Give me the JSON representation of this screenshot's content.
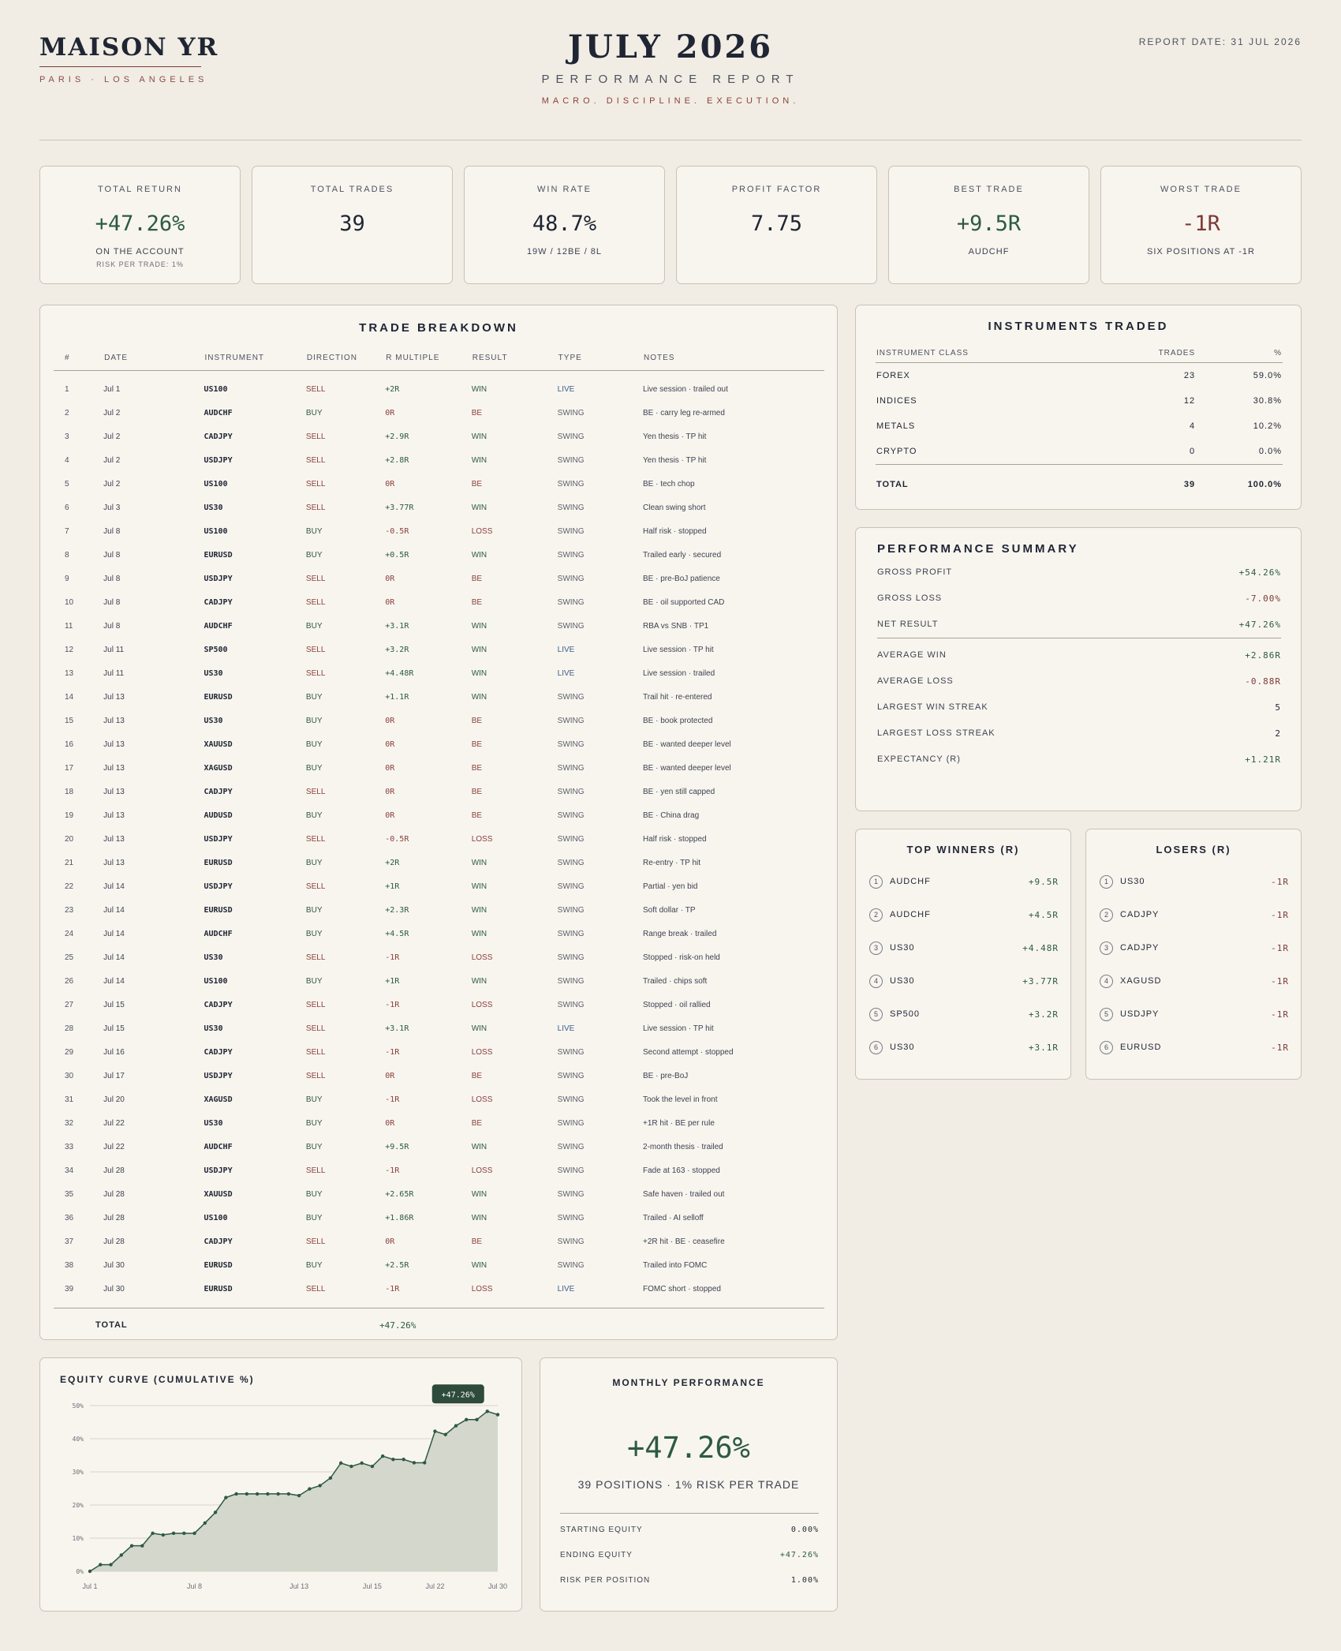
{
  "header": {
    "brand": "MAISON YR",
    "brand_sub": "PARIS · LOS ANGELES",
    "title": "JULY 2026",
    "subtitle": "PERFORMANCE REPORT",
    "tagline": "MACRO. DISCIPLINE. EXECUTION.",
    "report_date": "REPORT DATE: 31 JUL 2026"
  },
  "kpis": [
    {
      "label": "TOTAL RETURN",
      "value": "+47.26%",
      "sub1": "ON THE ACCOUNT",
      "sub2": "RISK PER TRADE: 1%",
      "tone": "pos"
    },
    {
      "label": "TOTAL TRADES",
      "value": "39",
      "sub1": "",
      "sub2": "",
      "tone": ""
    },
    {
      "label": "WIN RATE",
      "value": "48.7%",
      "sub1": "19W / 12BE / 8L",
      "sub2": "",
      "tone": ""
    },
    {
      "label": "PROFIT FACTOR",
      "value": "7.75",
      "sub1": "",
      "sub2": "",
      "tone": ""
    },
    {
      "label": "BEST TRADE",
      "value": "+9.5R",
      "sub1": "AUDCHF",
      "sub2": "",
      "tone": "pos"
    },
    {
      "label": "WORST TRADE",
      "value": "-1R",
      "sub1": "SIX POSITIONS AT -1R",
      "sub2": "",
      "tone": "neg"
    }
  ],
  "trades": {
    "title": "TRADE BREAKDOWN",
    "columns": [
      "#",
      "DATE",
      "INSTRUMENT",
      "DIRECTION",
      "R MULTIPLE",
      "RESULT",
      "TYPE",
      "NOTES"
    ],
    "rows": [
      [
        "1",
        "Jul 1",
        "US100",
        "SELL",
        "+2R",
        "WIN",
        "LIVE",
        "Live session · trailed out"
      ],
      [
        "2",
        "Jul 2",
        "AUDCHF",
        "BUY",
        "0R",
        "BE",
        "SWING",
        "BE · carry leg re-armed"
      ],
      [
        "3",
        "Jul 2",
        "CADJPY",
        "SELL",
        "+2.9R",
        "WIN",
        "SWING",
        "Yen thesis · TP hit"
      ],
      [
        "4",
        "Jul 2",
        "USDJPY",
        "SELL",
        "+2.8R",
        "WIN",
        "SWING",
        "Yen thesis · TP hit"
      ],
      [
        "5",
        "Jul 2",
        "US100",
        "SELL",
        "0R",
        "BE",
        "SWING",
        "BE · tech chop"
      ],
      [
        "6",
        "Jul 3",
        "US30",
        "SELL",
        "+3.77R",
        "WIN",
        "SWING",
        "Clean swing short"
      ],
      [
        "7",
        "Jul 8",
        "US100",
        "BUY",
        "-0.5R",
        "LOSS",
        "SWING",
        "Half risk · stopped"
      ],
      [
        "8",
        "Jul 8",
        "EURUSD",
        "BUY",
        "+0.5R",
        "WIN",
        "SWING",
        "Trailed early · secured"
      ],
      [
        "9",
        "Jul 8",
        "USDJPY",
        "SELL",
        "0R",
        "BE",
        "SWING",
        "BE · pre-BoJ patience"
      ],
      [
        "10",
        "Jul 8",
        "CADJPY",
        "SELL",
        "0R",
        "BE",
        "SWING",
        "BE · oil supported CAD"
      ],
      [
        "11",
        "Jul 8",
        "AUDCHF",
        "BUY",
        "+3.1R",
        "WIN",
        "SWING",
        "RBA vs SNB · TP1"
      ],
      [
        "12",
        "Jul 11",
        "SP500",
        "SELL",
        "+3.2R",
        "WIN",
        "LIVE",
        "Live session · TP hit"
      ],
      [
        "13",
        "Jul 11",
        "US30",
        "SELL",
        "+4.48R",
        "WIN",
        "LIVE",
        "Live session · trailed"
      ],
      [
        "14",
        "Jul 13",
        "EURUSD",
        "BUY",
        "+1.1R",
        "WIN",
        "SWING",
        "Trail hit · re-entered"
      ],
      [
        "15",
        "Jul 13",
        "US30",
        "BUY",
        "0R",
        "BE",
        "SWING",
        "BE · book protected"
      ],
      [
        "16",
        "Jul 13",
        "XAUUSD",
        "BUY",
        "0R",
        "BE",
        "SWING",
        "BE · wanted deeper level"
      ],
      [
        "17",
        "Jul 13",
        "XAGUSD",
        "BUY",
        "0R",
        "BE",
        "SWING",
        "BE · wanted deeper level"
      ],
      [
        "18",
        "Jul 13",
        "CADJPY",
        "SELL",
        "0R",
        "BE",
        "SWING",
        "BE · yen still capped"
      ],
      [
        "19",
        "Jul 13",
        "AUDUSD",
        "BUY",
        "0R",
        "BE",
        "SWING",
        "BE · China drag"
      ],
      [
        "20",
        "Jul 13",
        "USDJPY",
        "SELL",
        "-0.5R",
        "LOSS",
        "SWING",
        "Half risk · stopped"
      ],
      [
        "21",
        "Jul 13",
        "EURUSD",
        "BUY",
        "+2R",
        "WIN",
        "SWING",
        "Re-entry · TP hit"
      ],
      [
        "22",
        "Jul 14",
        "USDJPY",
        "SELL",
        "+1R",
        "WIN",
        "SWING",
        "Partial · yen bid"
      ],
      [
        "23",
        "Jul 14",
        "EURUSD",
        "BUY",
        "+2.3R",
        "WIN",
        "SWING",
        "Soft dollar · TP"
      ],
      [
        "24",
        "Jul 14",
        "AUDCHF",
        "BUY",
        "+4.5R",
        "WIN",
        "SWING",
        "Range break · trailed"
      ],
      [
        "25",
        "Jul 14",
        "US30",
        "SELL",
        "-1R",
        "LOSS",
        "SWING",
        "Stopped · risk-on held"
      ],
      [
        "26",
        "Jul 14",
        "US100",
        "BUY",
        "+1R",
        "WIN",
        "SWING",
        "Trailed · chips soft"
      ],
      [
        "27",
        "Jul 15",
        "CADJPY",
        "SELL",
        "-1R",
        "LOSS",
        "SWING",
        "Stopped · oil rallied"
      ],
      [
        "28",
        "Jul 15",
        "US30",
        "SELL",
        "+3.1R",
        "WIN",
        "LIVE",
        "Live session · TP hit"
      ],
      [
        "29",
        "Jul 16",
        "CADJPY",
        "SELL",
        "-1R",
        "LOSS",
        "SWING",
        "Second attempt · stopped"
      ],
      [
        "30",
        "Jul 17",
        "USDJPY",
        "SELL",
        "0R",
        "BE",
        "SWING",
        "BE · pre-BoJ"
      ],
      [
        "31",
        "Jul 20",
        "XAGUSD",
        "BUY",
        "-1R",
        "LOSS",
        "SWING",
        "Took the level in front"
      ],
      [
        "32",
        "Jul 22",
        "US30",
        "BUY",
        "0R",
        "BE",
        "SWING",
        "+1R hit · BE per rule"
      ],
      [
        "33",
        "Jul 22",
        "AUDCHF",
        "BUY",
        "+9.5R",
        "WIN",
        "SWING",
        "2-month thesis · trailed"
      ],
      [
        "34",
        "Jul 28",
        "USDJPY",
        "SELL",
        "-1R",
        "LOSS",
        "SWING",
        "Fade at 163 · stopped"
      ],
      [
        "35",
        "Jul 28",
        "XAUUSD",
        "BUY",
        "+2.65R",
        "WIN",
        "SWING",
        "Safe haven · trailed out"
      ],
      [
        "36",
        "Jul 28",
        "US100",
        "BUY",
        "+1.86R",
        "WIN",
        "SWING",
        "Trailed · AI selloff"
      ],
      [
        "37",
        "Jul 28",
        "CADJPY",
        "SELL",
        "0R",
        "BE",
        "SWING",
        "+2R hit · BE · ceasefire"
      ],
      [
        "38",
        "Jul 30",
        "EURUSD",
        "BUY",
        "+2.5R",
        "WIN",
        "SWING",
        "Trailed into FOMC"
      ],
      [
        "39",
        "Jul 30",
        "EURUSD",
        "SELL",
        "-1R",
        "LOSS",
        "LIVE",
        "FOMC short · stopped"
      ]
    ],
    "total_label": "TOTAL",
    "total_value": "+47.26%"
  },
  "instruments": {
    "title": "INSTRUMENTS TRADED",
    "columns": [
      "INSTRUMENT CLASS",
      "TRADES",
      "%"
    ],
    "rows": [
      [
        "FOREX",
        "23",
        "59.0%"
      ],
      [
        "INDICES",
        "12",
        "30.8%"
      ],
      [
        "METALS",
        "4",
        "10.2%"
      ],
      [
        "CRYPTO",
        "0",
        "0.0%"
      ]
    ],
    "total": [
      "TOTAL",
      "39",
      "100.0%"
    ]
  },
  "performance": {
    "title": "PERFORMANCE SUMMARY",
    "rows": [
      {
        "label": "GROSS PROFIT",
        "value": "+54.26%",
        "tone": "pos"
      },
      {
        "label": "GROSS LOSS",
        "value": "-7.00%",
        "tone": "neg"
      },
      {
        "label": "NET RESULT",
        "value": "+47.26%",
        "tone": "pos"
      },
      {
        "label": "AVERAGE WIN",
        "value": "+2.86R",
        "tone": "pos"
      },
      {
        "label": "AVERAGE LOSS",
        "value": "-0.88R",
        "tone": "neg"
      },
      {
        "label": "LARGEST WIN STREAK",
        "value": "5",
        "tone": ""
      },
      {
        "label": "LARGEST LOSS STREAK",
        "value": "2",
        "tone": ""
      },
      {
        "label": "EXPECTANCY (R)",
        "value": "+1.21R",
        "tone": "pos"
      }
    ]
  },
  "winners": {
    "title": "TOP WINNERS (R)",
    "rows": [
      [
        "1",
        "AUDCHF",
        "+9.5R"
      ],
      [
        "2",
        "AUDCHF",
        "+4.5R"
      ],
      [
        "3",
        "US30",
        "+4.48R"
      ],
      [
        "4",
        "US30",
        "+3.77R"
      ],
      [
        "5",
        "SP500",
        "+3.2R"
      ],
      [
        "6",
        "US30",
        "+3.1R"
      ]
    ]
  },
  "losers": {
    "title": "LOSERS (R)",
    "rows": [
      [
        "1",
        "US30",
        "-1R"
      ],
      [
        "2",
        "CADJPY",
        "-1R"
      ],
      [
        "3",
        "CADJPY",
        "-1R"
      ],
      [
        "4",
        "XAGUSD",
        "-1R"
      ],
      [
        "5",
        "USDJPY",
        "-1R"
      ],
      [
        "6",
        "EURUSD",
        "-1R"
      ]
    ]
  },
  "equity": {
    "title": "EQUITY CURVE (CUMULATIVE %)",
    "badge": "+47.26%"
  },
  "monthly": {
    "title": "MONTHLY PERFORMANCE",
    "value": "+47.26%",
    "sub": "39 POSITIONS · 1% RISK PER TRADE",
    "rows": [
      {
        "label": "STARTING EQUITY",
        "value": "0.00%",
        "tone": ""
      },
      {
        "label": "ENDING EQUITY",
        "value": "+47.26%",
        "tone": "pos"
      },
      {
        "label": "RISK PER POSITION",
        "value": "1.00%",
        "tone": ""
      }
    ]
  },
  "colors": {
    "positive": "#2d5a43",
    "negative": "#7c3a37",
    "background": "#f1ede4",
    "card": "#f8f5ef"
  },
  "chart_data": {
    "type": "area",
    "title": "EQUITY CURVE (CUMULATIVE %)",
    "xlabel": "",
    "ylabel": "",
    "x_ticks": [
      "Jul 1",
      "Jul 8",
      "Jul 13",
      "Jul 15",
      "Jul 22",
      "Jul 30"
    ],
    "y_ticks": [
      "0%",
      "10%",
      "20%",
      "30%",
      "40%",
      "50%"
    ],
    "ylim": [
      0,
      50
    ],
    "grid": true,
    "series": [
      {
        "values": [
          0,
          2,
          2,
          4.9,
          7.7,
          7.7,
          11.47,
          10.97,
          11.47,
          11.47,
          11.47,
          14.57,
          17.77,
          22.25,
          23.35,
          23.35,
          23.35,
          23.35,
          23.35,
          23.35,
          22.85,
          24.85,
          25.85,
          28.15,
          32.65,
          31.65,
          32.65,
          31.65,
          34.75,
          33.75,
          33.75,
          32.75,
          32.75,
          42.25,
          41.25,
          43.9,
          45.76,
          45.76,
          48.26,
          47.26
        ]
      }
    ]
  }
}
